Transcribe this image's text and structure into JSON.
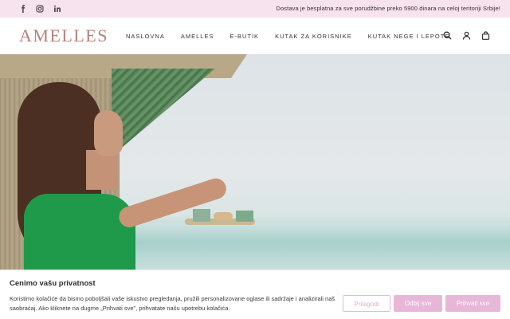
{
  "topbar": {
    "social_icons": [
      "facebook-icon",
      "instagram-icon",
      "linkedin-icon"
    ],
    "shipping_text": "Dostava je besplatna za sve porudžbine preko 5900 dinara na celoj teritoriji Srbije!"
  },
  "header": {
    "logo": "AMELLES",
    "nav": [
      "NASLOVNA",
      "AMELLES",
      "E-BUTIK",
      "KUTAK ZA KORISNIKE",
      "KUTAK NEGE I LEPOTE"
    ],
    "icons": [
      "search-icon",
      "account-icon",
      "cart-icon"
    ]
  },
  "cookie": {
    "title": "Cenimo vašu privatnost",
    "text": "Koristimo kolačiće da bismo poboljšali vaše iskustvo pregledanja, pružili personalizovane oglase ili sadržaje i analizirali naš saobraćaj. Ako kliknete na dugme „Prihvati sve\", prihvatate našu upotrebu kolačića.",
    "customize_label": "Prilagodi",
    "reject_label": "Odbij sve",
    "accept_label": "Prihvati sve"
  },
  "colors": {
    "topbar_bg": "#f6e3ee",
    "logo": "#b7817a",
    "button_pink": "#e8b6d7"
  }
}
